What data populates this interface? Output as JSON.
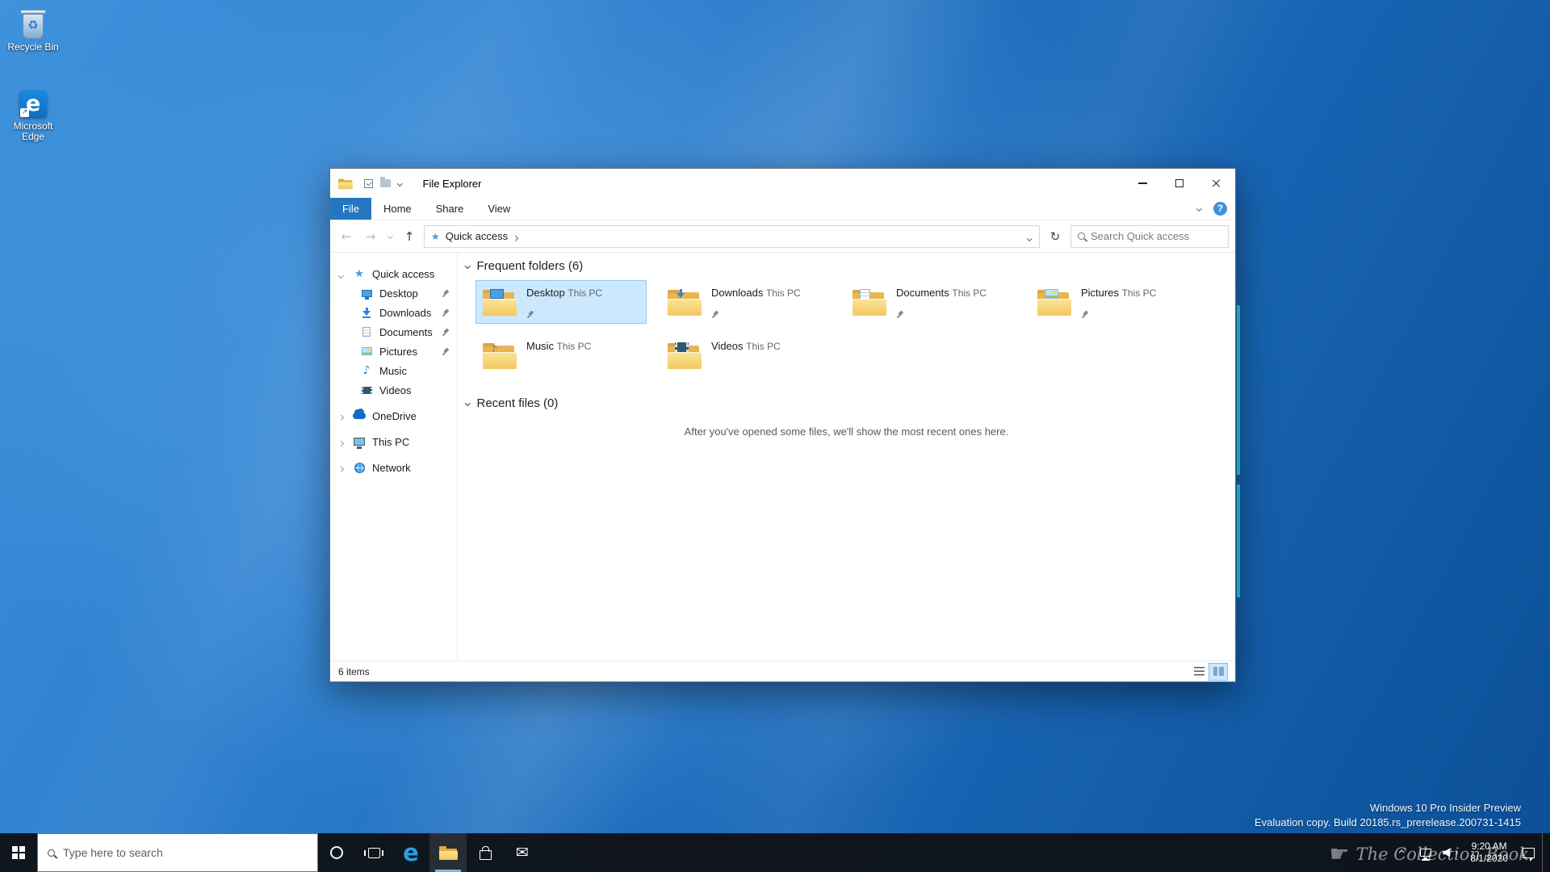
{
  "desktop": {
    "icons": [
      {
        "label": "Recycle Bin"
      },
      {
        "label": "Microsoft Edge"
      }
    ],
    "build_watermark": {
      "line1": "Windows 10 Pro Insider Preview",
      "line2": "Evaluation copy. Build 20185.rs_prerelease.200731-1415"
    },
    "overlay_watermark": "The Collection Book"
  },
  "explorer": {
    "window_title": "File Explorer",
    "tabs": {
      "file": "File",
      "home": "Home",
      "share": "Share",
      "view": "View"
    },
    "address": {
      "breadcrumb": "Quick access",
      "search_placeholder": "Search Quick access"
    },
    "sidebar": {
      "items": [
        {
          "label": "Quick access"
        },
        {
          "label": "Desktop"
        },
        {
          "label": "Downloads"
        },
        {
          "label": "Documents"
        },
        {
          "label": "Pictures"
        },
        {
          "label": "Music"
        },
        {
          "label": "Videos"
        },
        {
          "label": "OneDrive"
        },
        {
          "label": "This PC"
        },
        {
          "label": "Network"
        }
      ]
    },
    "content": {
      "frequent_header": "Frequent folders (6)",
      "folders": [
        {
          "name": "Desktop",
          "location": "This PC"
        },
        {
          "name": "Downloads",
          "location": "This PC"
        },
        {
          "name": "Documents",
          "location": "This PC"
        },
        {
          "name": "Pictures",
          "location": "This PC"
        },
        {
          "name": "Music",
          "location": "This PC"
        },
        {
          "name": "Videos",
          "location": "This PC"
        }
      ],
      "recent_header": "Recent files (0)",
      "recent_empty_message": "After you've opened some files, we'll show the most recent ones here."
    },
    "statusbar": {
      "item_count": "6 items"
    }
  },
  "taskbar": {
    "search_placeholder": "Type here to search",
    "clock": {
      "time": "9:20 AM",
      "date": "8/1/2020"
    }
  },
  "colors": {
    "accent_blue": "#2576c2",
    "selection_blue": "#cce8ff",
    "taskbar_bg": "#101318",
    "folder_yellow": "#f3c75f",
    "cyan_accent": "#2de0e8"
  }
}
